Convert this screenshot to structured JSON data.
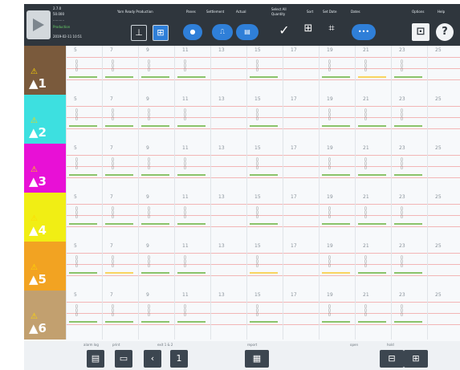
{
  "header": {
    "info": [
      "2.7.0",
      "50.000",
      "...........",
      "Production"
    ],
    "datetime": "2019-02-11 10:51",
    "nav": [
      "Yarn Ready Production",
      "Panes",
      "Settlement",
      "Actual",
      "Select All",
      "Quantity",
      "Sort",
      "Set Date",
      "Dates"
    ],
    "right_labels": [
      "Options",
      "Help"
    ]
  },
  "rows": [
    {
      "label": "1",
      "color": "#7a5a3c"
    },
    {
      "label": "2",
      "color": "#3de0e0"
    },
    {
      "label": "3",
      "color": "#e810d6"
    },
    {
      "label": "4",
      "color": "#f1ee14"
    },
    {
      "label": "5",
      "color": "#f2a322"
    },
    {
      "label": "6",
      "color": "#c2a06f"
    }
  ],
  "dates": [
    "5",
    "7",
    "9",
    "11",
    "13",
    "15",
    "17",
    "19",
    "21",
    "23",
    "25"
  ],
  "bottom": {
    "labels": [
      "alarm log",
      "print",
      "exit 1 & 2",
      "report",
      "open",
      "hold"
    ],
    "page": "1"
  },
  "colors": {
    "accent": "#2f7fd8",
    "topbar": "#2f363d",
    "bar_green": "#8ac46b",
    "bar_yellow": "#f8d560"
  }
}
